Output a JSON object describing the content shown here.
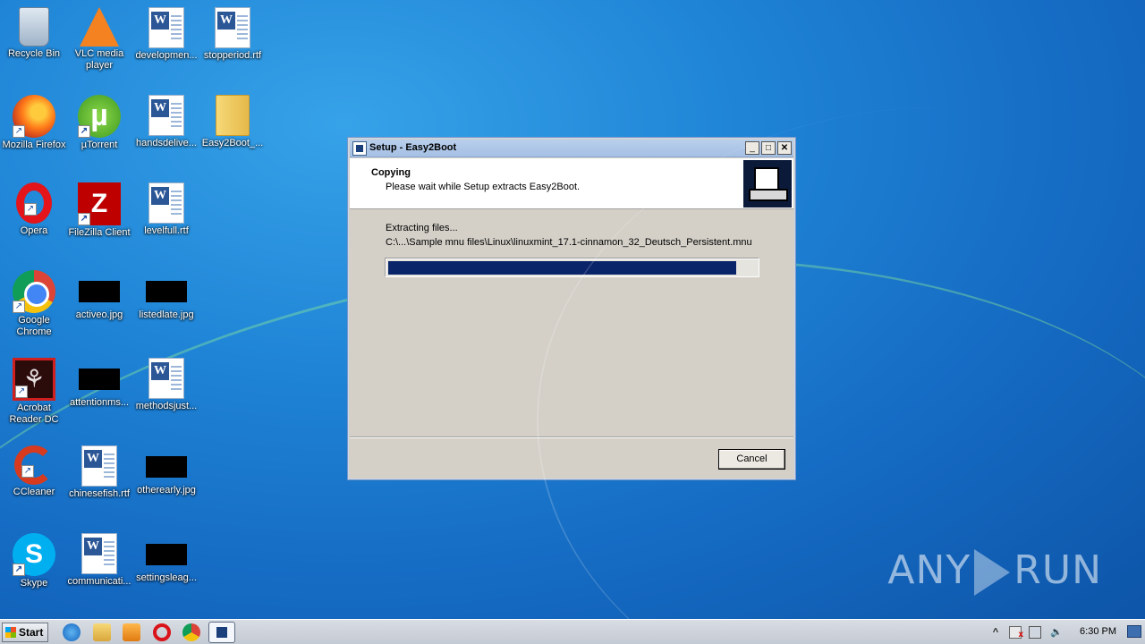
{
  "desktop": {
    "icons": [
      {
        "label": "Recycle Bin",
        "icon": "recycle-bin-icon"
      },
      {
        "label": "VLC media player",
        "icon": "vlc-icon"
      },
      {
        "label": "developmen...",
        "icon": "word-document-icon"
      },
      {
        "label": "stopperiod.rtf",
        "icon": "word-document-icon"
      },
      {
        "label": "Mozilla Firefox",
        "icon": "firefox-icon"
      },
      {
        "label": "µTorrent",
        "icon": "utorrent-icon"
      },
      {
        "label": "handsdelive...",
        "icon": "word-document-icon"
      },
      {
        "label": "Easy2Boot_...",
        "icon": "folder-icon"
      },
      {
        "label": "Opera",
        "icon": "opera-icon"
      },
      {
        "label": "FileZilla Client",
        "icon": "filezilla-icon"
      },
      {
        "label": "levelfull.rtf",
        "icon": "word-document-icon"
      },
      {
        "label": "Google Chrome",
        "icon": "chrome-icon"
      },
      {
        "label": "activeo.jpg",
        "icon": "image-file-icon"
      },
      {
        "label": "listedlate.jpg",
        "icon": "image-file-icon"
      },
      {
        "label": "Acrobat Reader DC",
        "icon": "acrobat-icon"
      },
      {
        "label": "attentionms...",
        "icon": "image-file-icon"
      },
      {
        "label": "methodsjust...",
        "icon": "word-document-icon"
      },
      {
        "label": "CCleaner",
        "icon": "ccleaner-icon"
      },
      {
        "label": "chinesefish.rtf",
        "icon": "word-document-icon"
      },
      {
        "label": "otherearly.jpg",
        "icon": "image-file-icon"
      },
      {
        "label": "Skype",
        "icon": "skype-icon"
      },
      {
        "label": "communicati...",
        "icon": "word-document-icon"
      },
      {
        "label": "settingsleag...",
        "icon": "image-file-icon"
      }
    ]
  },
  "dialog": {
    "title": "Setup - Easy2Boot",
    "header_title": "Copying",
    "header_subtitle": "Please wait while Setup extracts Easy2Boot.",
    "status": "Extracting files...",
    "current_file": "C:\\...\\Sample mnu files\\Linux\\linuxmint_17.1-cinnamon_32_Deutsch_Persistent.mnu",
    "progress_fraction": 0.945,
    "cancel_label": "Cancel",
    "min_symbol": "_",
    "max_symbol": "□",
    "close_symbol": "✕"
  },
  "taskbar": {
    "start_label": "Start",
    "clock": "6:30 PM",
    "tray_up_symbol": "^",
    "tray_volume_symbol": "🔈",
    "apps": [
      "internet-explorer-icon",
      "windows-explorer-icon",
      "media-player-icon",
      "opera-icon",
      "chrome-icon",
      "setup-icon"
    ]
  },
  "watermark": {
    "left": "ANY",
    "right": "RUN"
  },
  "colors": {
    "progress": "#0a246a",
    "desktop": "#1f84d6"
  }
}
